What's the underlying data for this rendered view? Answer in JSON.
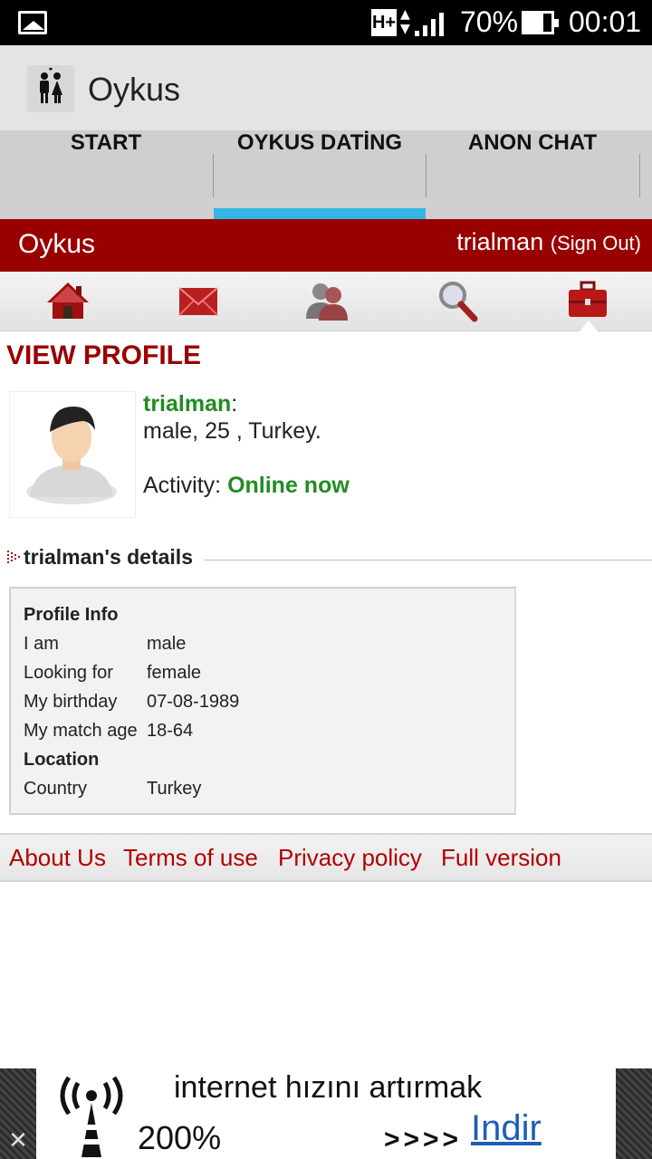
{
  "status_bar": {
    "network": "H+",
    "battery_percent": "70%",
    "battery_level": 0.7,
    "time": "00:01",
    "icons": [
      "gallery-icon",
      "network-arrows-icon",
      "signal-icon",
      "battery-icon"
    ]
  },
  "app_bar": {
    "title": "Oykus",
    "icon": "couple-icon"
  },
  "tabs": [
    {
      "label": "START",
      "selected": false
    },
    {
      "label": "OYKUS DATİNG",
      "selected": true
    },
    {
      "label": "ANON CHAT",
      "selected": false
    }
  ],
  "site_bar": {
    "title": "Oykus",
    "username": "trialman",
    "sign_out": "(Sign Out)"
  },
  "nav_icons": [
    "home-icon",
    "mail-icon",
    "people-icon",
    "search-icon",
    "briefcase-icon"
  ],
  "page": {
    "heading": "VIEW PROFILE",
    "profile": {
      "name": "trialman",
      "colon": ":",
      "summary": "male, 25 , Turkey.",
      "activity_label": "Activity:",
      "activity_status": "Online now"
    },
    "details_heading": "trialman's details",
    "details": {
      "section1": "Profile Info",
      "rows1": [
        {
          "label": "I am",
          "value": "male"
        },
        {
          "label": "Looking for",
          "value": "female"
        },
        {
          "label": "My birthday",
          "value": "07-08-1989"
        },
        {
          "label": "My match age",
          "value": "18-64"
        }
      ],
      "section2": "Location",
      "rows2": [
        {
          "label": "Country",
          "value": "Turkey"
        }
      ]
    }
  },
  "footer_links": [
    "About Us",
    "Terms of use",
    "Privacy policy",
    "Full version"
  ],
  "ad": {
    "line1": "internet hızını artırmak",
    "percent": "200%",
    "arrows": ">>>>",
    "cta": "Indir",
    "close": "✕"
  },
  "colors": {
    "accent": "#990000",
    "tab_indicator": "#33b5e5",
    "online": "#228b22",
    "link": "#b00000"
  }
}
